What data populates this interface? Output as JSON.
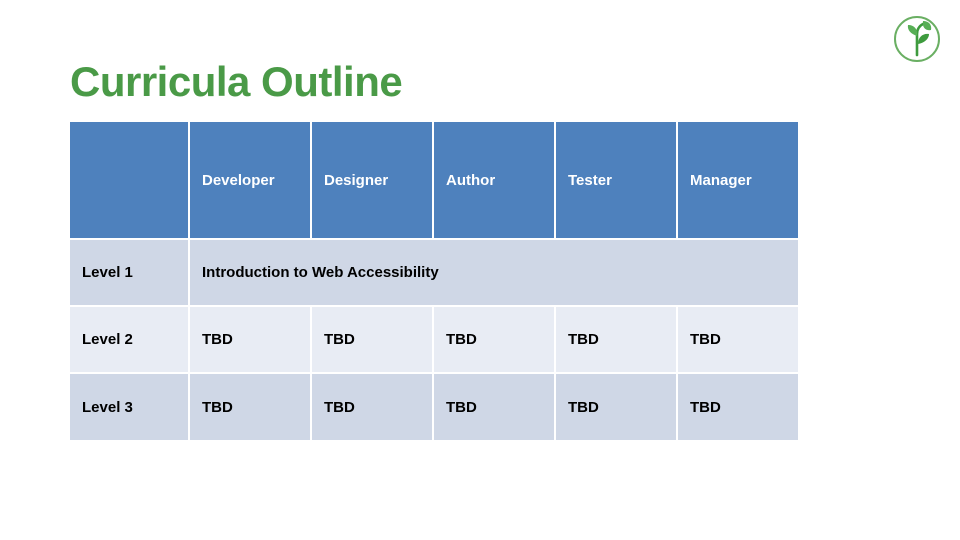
{
  "slide": {
    "title": "Curricula Outline",
    "title_color": "#4A9A47",
    "background": "#FFFFFF"
  },
  "logo": {
    "name": "sprout-in-circle-logo",
    "color": "#4A9A47"
  },
  "table": {
    "header_bg": "#4E81BD",
    "header_text_color": "#FFFFFF",
    "row_band_dark": "#CFD7E6",
    "row_band_light": "#E8ECF4",
    "columns": [
      {
        "label": ""
      },
      {
        "label": "Developer"
      },
      {
        "label": "Designer"
      },
      {
        "label": "Author"
      },
      {
        "label": "Tester"
      },
      {
        "label": "Manager"
      }
    ],
    "rows": [
      {
        "label": "Level 1",
        "merged": true,
        "merged_value": "Introduction to Web Accessibility",
        "cells": []
      },
      {
        "label": "Level 2",
        "merged": false,
        "cells": [
          "TBD",
          "TBD",
          "TBD",
          "TBD",
          "TBD"
        ]
      },
      {
        "label": "Level 3",
        "merged": false,
        "cells": [
          "TBD",
          "TBD",
          "TBD",
          "TBD",
          "TBD"
        ]
      }
    ]
  }
}
